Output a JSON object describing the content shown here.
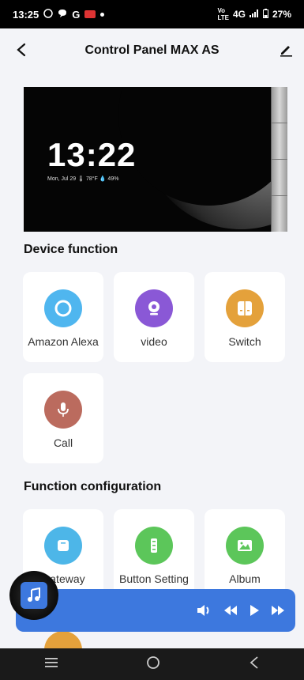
{
  "status": {
    "time": "13:25",
    "network": "4G",
    "battery": "27%",
    "icons": [
      "whatsapp-icon",
      "chat-icon",
      "google-icon",
      "app-icon"
    ]
  },
  "header": {
    "title": "Control Panel MAX AS",
    "back_icon": "back-arrow-icon",
    "edit_icon": "edit-pencil-icon"
  },
  "device": {
    "clock": "13:22",
    "date_info": "Mon, Jul 29   🌡 78°F   💧 49%"
  },
  "device_function": {
    "title": "Device function",
    "items": [
      {
        "label": "Amazon Alexa",
        "icon": "alexa-icon",
        "color": "#4fb6ef"
      },
      {
        "label": "video",
        "icon": "camera-icon",
        "color": "#8a58d6"
      },
      {
        "label": "Switch",
        "icon": "switch-icon",
        "color": "#e4a13b"
      },
      {
        "label": "Call",
        "icon": "microphone-icon",
        "color": "#bb6b5e"
      }
    ]
  },
  "function_configuration": {
    "title": "Function configuration",
    "items": [
      {
        "label": "Gateway",
        "icon": "gateway-icon",
        "color": "#4db6e8"
      },
      {
        "label": "Button Setting",
        "icon": "button-setting-icon",
        "color": "#5cc65a"
      },
      {
        "label": "Album",
        "icon": "album-icon",
        "color": "#5cc65a"
      }
    ]
  },
  "music_player": {
    "icons": [
      "music-note-icon",
      "volume-icon",
      "rewind-icon",
      "play-icon",
      "fast-forward-icon"
    ],
    "color": "#3d78de"
  },
  "nav": {
    "icons": [
      "recent-apps-icon",
      "home-icon",
      "back-icon"
    ]
  }
}
